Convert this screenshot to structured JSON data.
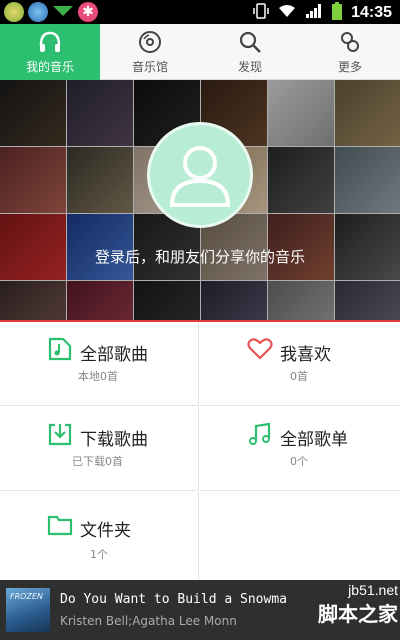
{
  "status_bar": {
    "time": "14:35"
  },
  "tabs": [
    {
      "label": "我的音乐",
      "icon": "headphones-icon",
      "active": true
    },
    {
      "label": "音乐馆",
      "icon": "disc-icon",
      "active": false
    },
    {
      "label": "发现",
      "icon": "search-icon",
      "active": false
    },
    {
      "label": "更多",
      "icon": "more-icon",
      "active": false
    }
  ],
  "banner": {
    "login_prompt": "登录后，和朋友们分享你的音乐"
  },
  "grid": [
    {
      "title": "全部歌曲",
      "sub": "本地0首",
      "icon": "music-file-icon"
    },
    {
      "title": "我喜欢",
      "sub": "0首",
      "icon": "heart-icon"
    },
    {
      "title": "下载歌曲",
      "sub": "已下载0首",
      "icon": "download-icon"
    },
    {
      "title": "全部歌单",
      "sub": "0个",
      "icon": "music-note-icon"
    },
    {
      "title": "文件夹",
      "sub": "1个",
      "icon": "folder-icon"
    }
  ],
  "player": {
    "song": "Do You Want to Build a Snowma",
    "artist": "Kristen Bell;Agatha Lee Monn",
    "cover_text": "FROZEN"
  },
  "watermark": {
    "line1": "jb51.net",
    "line2": "脚本之家"
  },
  "colors": {
    "accent": "#2cbf6f",
    "heart": "#e85454",
    "divider": "#e23b3b"
  }
}
